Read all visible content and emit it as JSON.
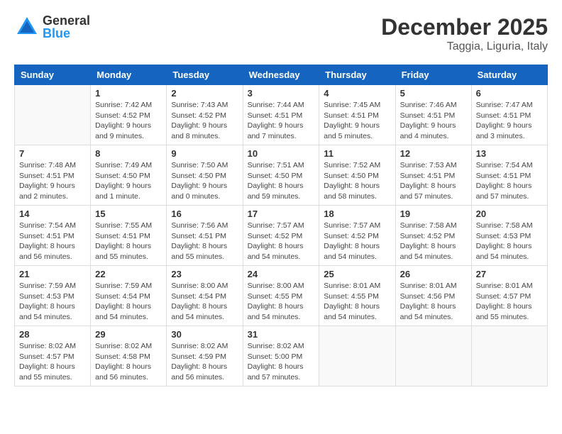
{
  "logo": {
    "general": "General",
    "blue": "Blue"
  },
  "title": {
    "month": "December 2025",
    "location": "Taggia, Liguria, Italy"
  },
  "headers": [
    "Sunday",
    "Monday",
    "Tuesday",
    "Wednesday",
    "Thursday",
    "Friday",
    "Saturday"
  ],
  "weeks": [
    [
      {
        "day": "",
        "info": ""
      },
      {
        "day": "1",
        "info": "Sunrise: 7:42 AM\nSunset: 4:52 PM\nDaylight: 9 hours\nand 9 minutes."
      },
      {
        "day": "2",
        "info": "Sunrise: 7:43 AM\nSunset: 4:52 PM\nDaylight: 9 hours\nand 8 minutes."
      },
      {
        "day": "3",
        "info": "Sunrise: 7:44 AM\nSunset: 4:51 PM\nDaylight: 9 hours\nand 7 minutes."
      },
      {
        "day": "4",
        "info": "Sunrise: 7:45 AM\nSunset: 4:51 PM\nDaylight: 9 hours\nand 5 minutes."
      },
      {
        "day": "5",
        "info": "Sunrise: 7:46 AM\nSunset: 4:51 PM\nDaylight: 9 hours\nand 4 minutes."
      },
      {
        "day": "6",
        "info": "Sunrise: 7:47 AM\nSunset: 4:51 PM\nDaylight: 9 hours\nand 3 minutes."
      }
    ],
    [
      {
        "day": "7",
        "info": "Sunrise: 7:48 AM\nSunset: 4:51 PM\nDaylight: 9 hours\nand 2 minutes."
      },
      {
        "day": "8",
        "info": "Sunrise: 7:49 AM\nSunset: 4:50 PM\nDaylight: 9 hours\nand 1 minute."
      },
      {
        "day": "9",
        "info": "Sunrise: 7:50 AM\nSunset: 4:50 PM\nDaylight: 9 hours\nand 0 minutes."
      },
      {
        "day": "10",
        "info": "Sunrise: 7:51 AM\nSunset: 4:50 PM\nDaylight: 8 hours\nand 59 minutes."
      },
      {
        "day": "11",
        "info": "Sunrise: 7:52 AM\nSunset: 4:50 PM\nDaylight: 8 hours\nand 58 minutes."
      },
      {
        "day": "12",
        "info": "Sunrise: 7:53 AM\nSunset: 4:51 PM\nDaylight: 8 hours\nand 57 minutes."
      },
      {
        "day": "13",
        "info": "Sunrise: 7:54 AM\nSunset: 4:51 PM\nDaylight: 8 hours\nand 57 minutes."
      }
    ],
    [
      {
        "day": "14",
        "info": "Sunrise: 7:54 AM\nSunset: 4:51 PM\nDaylight: 8 hours\nand 56 minutes."
      },
      {
        "day": "15",
        "info": "Sunrise: 7:55 AM\nSunset: 4:51 PM\nDaylight: 8 hours\nand 55 minutes."
      },
      {
        "day": "16",
        "info": "Sunrise: 7:56 AM\nSunset: 4:51 PM\nDaylight: 8 hours\nand 55 minutes."
      },
      {
        "day": "17",
        "info": "Sunrise: 7:57 AM\nSunset: 4:52 PM\nDaylight: 8 hours\nand 54 minutes."
      },
      {
        "day": "18",
        "info": "Sunrise: 7:57 AM\nSunset: 4:52 PM\nDaylight: 8 hours\nand 54 minutes."
      },
      {
        "day": "19",
        "info": "Sunrise: 7:58 AM\nSunset: 4:52 PM\nDaylight: 8 hours\nand 54 minutes."
      },
      {
        "day": "20",
        "info": "Sunrise: 7:58 AM\nSunset: 4:53 PM\nDaylight: 8 hours\nand 54 minutes."
      }
    ],
    [
      {
        "day": "21",
        "info": "Sunrise: 7:59 AM\nSunset: 4:53 PM\nDaylight: 8 hours\nand 54 minutes."
      },
      {
        "day": "22",
        "info": "Sunrise: 7:59 AM\nSunset: 4:54 PM\nDaylight: 8 hours\nand 54 minutes."
      },
      {
        "day": "23",
        "info": "Sunrise: 8:00 AM\nSunset: 4:54 PM\nDaylight: 8 hours\nand 54 minutes."
      },
      {
        "day": "24",
        "info": "Sunrise: 8:00 AM\nSunset: 4:55 PM\nDaylight: 8 hours\nand 54 minutes."
      },
      {
        "day": "25",
        "info": "Sunrise: 8:01 AM\nSunset: 4:55 PM\nDaylight: 8 hours\nand 54 minutes."
      },
      {
        "day": "26",
        "info": "Sunrise: 8:01 AM\nSunset: 4:56 PM\nDaylight: 8 hours\nand 54 minutes."
      },
      {
        "day": "27",
        "info": "Sunrise: 8:01 AM\nSunset: 4:57 PM\nDaylight: 8 hours\nand 55 minutes."
      }
    ],
    [
      {
        "day": "28",
        "info": "Sunrise: 8:02 AM\nSunset: 4:57 PM\nDaylight: 8 hours\nand 55 minutes."
      },
      {
        "day": "29",
        "info": "Sunrise: 8:02 AM\nSunset: 4:58 PM\nDaylight: 8 hours\nand 56 minutes."
      },
      {
        "day": "30",
        "info": "Sunrise: 8:02 AM\nSunset: 4:59 PM\nDaylight: 8 hours\nand 56 minutes."
      },
      {
        "day": "31",
        "info": "Sunrise: 8:02 AM\nSunset: 5:00 PM\nDaylight: 8 hours\nand 57 minutes."
      },
      {
        "day": "",
        "info": ""
      },
      {
        "day": "",
        "info": ""
      },
      {
        "day": "",
        "info": ""
      }
    ]
  ]
}
